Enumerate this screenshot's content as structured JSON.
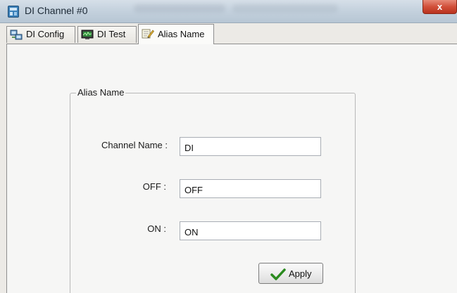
{
  "window": {
    "title": "DI Channel #0",
    "close_label": "x"
  },
  "tabs": [
    {
      "label": "DI Config",
      "icon": "network-config-icon",
      "active": false
    },
    {
      "label": "DI Test",
      "icon": "monitor-test-icon",
      "active": false
    },
    {
      "label": "Alias Name",
      "icon": "notepad-pencil-icon",
      "active": true
    }
  ],
  "alias_group": {
    "title": "Alias Name",
    "fields": [
      {
        "label": "Channel Name :",
        "value": "DI"
      },
      {
        "label": "OFF :",
        "value": "OFF"
      },
      {
        "label": "ON :",
        "value": "ON"
      }
    ],
    "apply_label": "Apply"
  },
  "colors": {
    "apply_check": "#2a8a1e",
    "close_button": "#d2503a"
  }
}
